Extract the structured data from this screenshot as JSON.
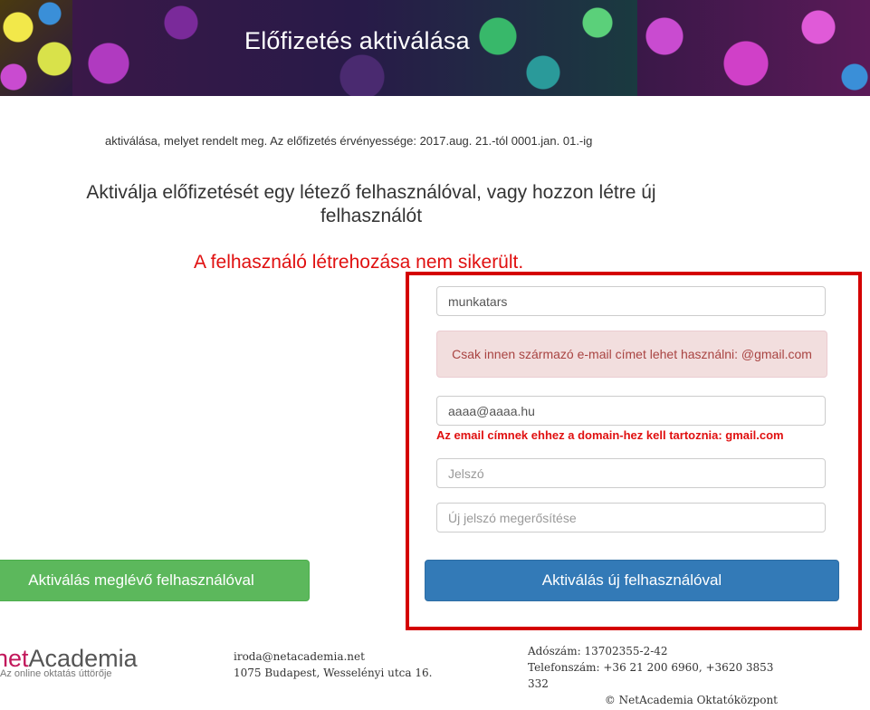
{
  "banner": {
    "title": "Előfizetés aktiválása"
  },
  "intro": {
    "text": "aktiválása, melyet rendelt meg. Az előfizetés érvényessége: 2017.aug. 21.-tól 0001.jan. 01.-ig"
  },
  "heading": {
    "text": "Aktiválja előfizetését egy létező felhasználóval, vagy hozzon létre új felhasználót"
  },
  "error": {
    "title": "A felhasználó létrehozása nem sikerült."
  },
  "form": {
    "username_value": "munkatars",
    "alert_text": "Csak innen származó e-mail címet lehet használni: @gmail.com",
    "email_value": "aaaa@aaaa.hu",
    "email_error": "Az email címnek ehhez a domain-hez kell tartoznia: gmail.com",
    "password_placeholder": "Jelszó",
    "password_confirm_placeholder": "Új jelszó megerősítése",
    "existing_user_button": "Aktiválás meglévő felhasználóval",
    "new_user_button": "Aktiválás új felhasználóval"
  },
  "footer": {
    "logo_net": "net",
    "logo_academia": "Academia",
    "logo_tagline": "Az online oktatás úttörője",
    "email": "iroda@netacademia.net",
    "address": "1075 Budapest, Wesselényi utca 16.",
    "tax_id": "Adószám: 13702355-2-42",
    "phone": "Telefonszám: +36 21 200 6960, +3620 3853 332",
    "copyright": "© NetAcademia Oktatóközpont"
  },
  "colors": {
    "error_red": "#e01010",
    "highlight_border": "#d40000",
    "primary_blue": "#337ab7",
    "success_green": "#5cb85c",
    "alert_bg": "#f2dede"
  }
}
